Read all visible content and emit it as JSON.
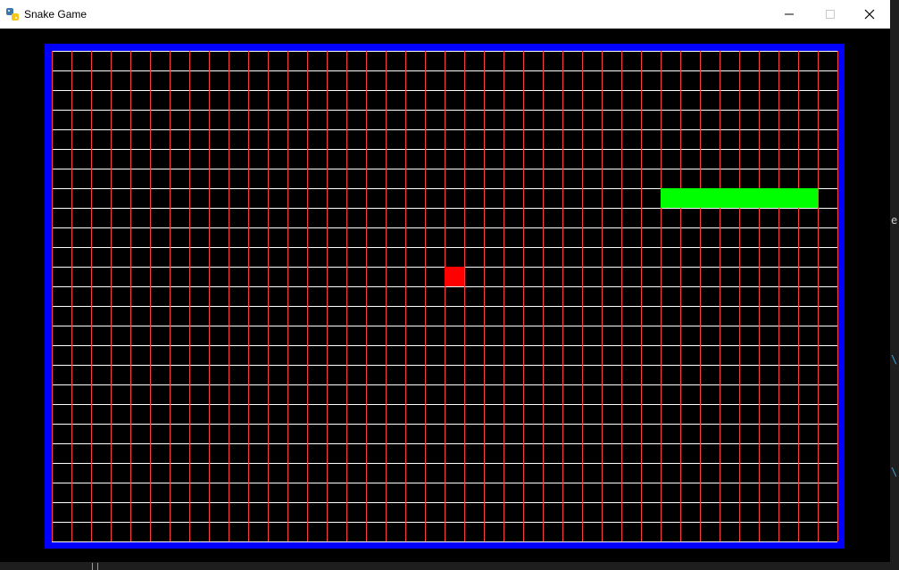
{
  "window": {
    "title": "Snake Game",
    "icon": "python-icon",
    "controls": [
      "minimize-icon",
      "maximize-icon",
      "close-icon"
    ]
  },
  "board": {
    "columns": 40,
    "rows": 25,
    "border_color": "#0000ff",
    "background_color": "#000000",
    "vertical_grid_color": "#ff3b3b",
    "horizontal_grid_color": "#ffffff"
  },
  "snake": {
    "color": "#00ff00",
    "cells": [
      [
        31,
        7
      ],
      [
        32,
        7
      ],
      [
        33,
        7
      ],
      [
        34,
        7
      ],
      [
        35,
        7
      ],
      [
        36,
        7
      ],
      [
        37,
        7
      ],
      [
        38,
        7
      ]
    ]
  },
  "food": {
    "color": "#ff0000",
    "cell": [
      20,
      11
    ]
  },
  "background_glyphs": [
    {
      "text": "e",
      "color": "#cccccc"
    },
    {
      "text": "\\",
      "color": "#3aa0d8"
    },
    {
      "text": "\\",
      "color": "#3aa0d8"
    }
  ]
}
